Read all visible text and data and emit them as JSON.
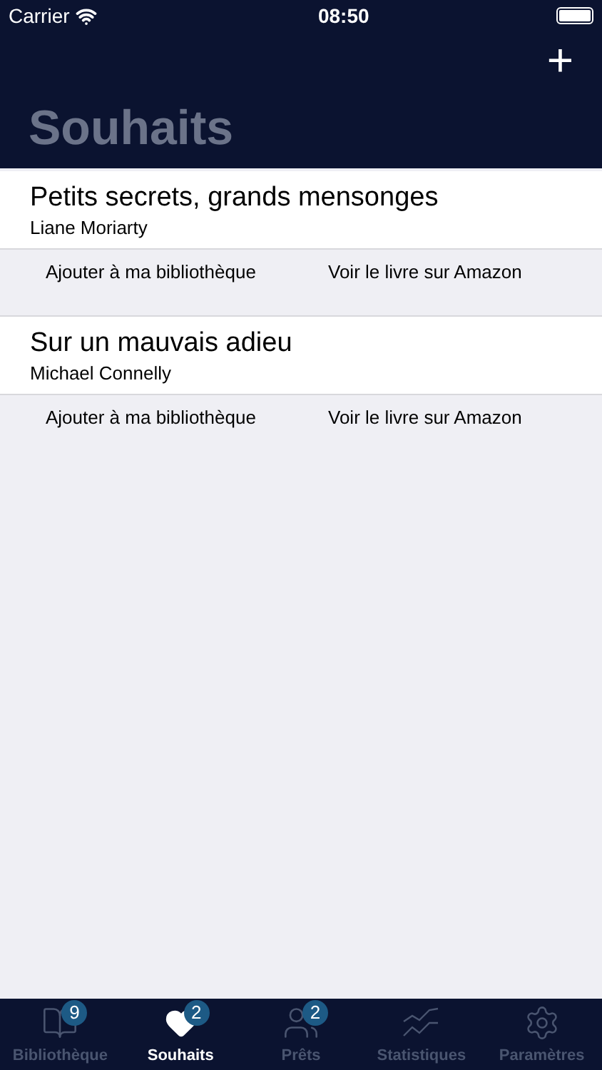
{
  "status_bar": {
    "carrier": "Carrier",
    "time": "08:50"
  },
  "nav": {
    "title": "Souhaits",
    "add_label": "+"
  },
  "books": [
    {
      "title": "Petits secrets, grands mensonges",
      "author": "Liane Moriarty",
      "actions": [
        "Ajouter à ma bibliothèque",
        "Voir le livre sur Amazon"
      ]
    },
    {
      "title": "Sur un mauvais adieu",
      "author": "Michael Connelly",
      "actions": [
        "Ajouter à ma bibliothèque",
        "Voir le livre sur Amazon"
      ]
    }
  ],
  "tabs": [
    {
      "kind": "book",
      "label": "Bibliothèque",
      "badge": "9",
      "selected": false
    },
    {
      "kind": "heart",
      "label": "Souhaits",
      "badge": "2",
      "selected": true
    },
    {
      "kind": "people",
      "label": "Prêts",
      "badge": "2",
      "selected": false
    },
    {
      "kind": "stats",
      "label": "Statistiques",
      "selected": false
    },
    {
      "kind": "gear",
      "label": "Paramètres",
      "selected": false
    }
  ]
}
